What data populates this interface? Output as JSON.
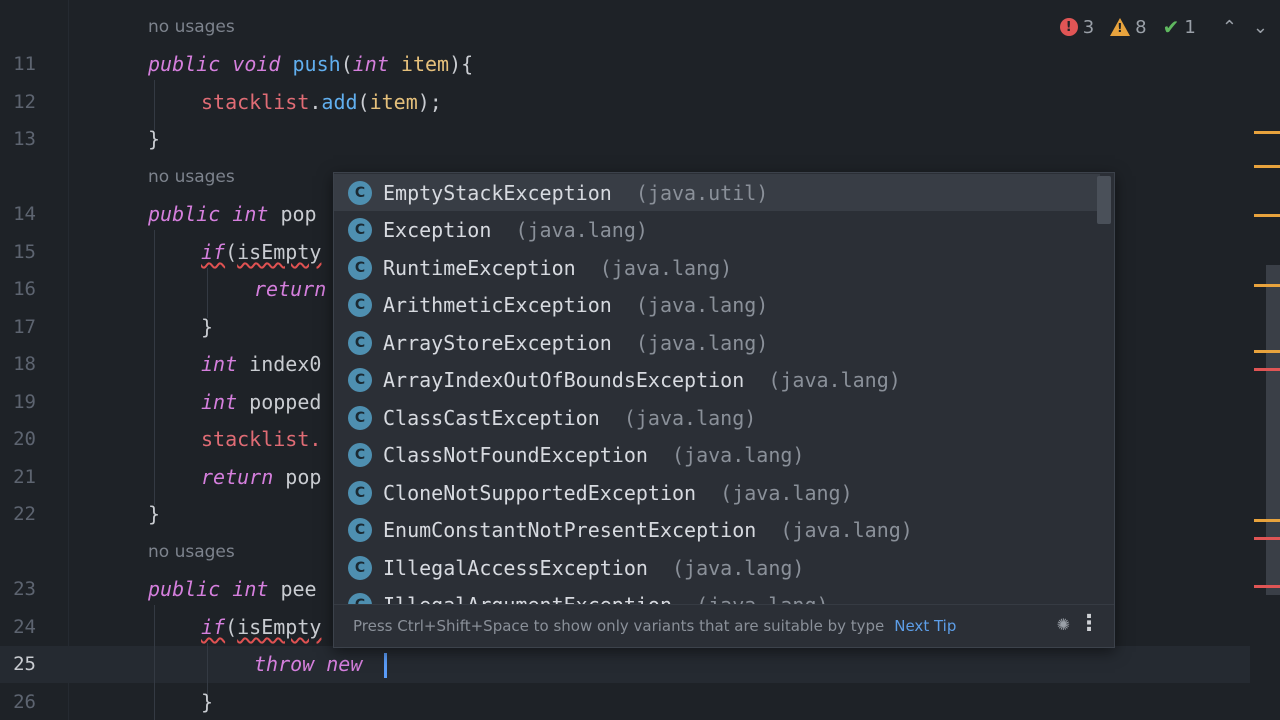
{
  "inspections": {
    "errors": "3",
    "warnings": "8",
    "ok": "1"
  },
  "hints": {
    "usages": "no usages"
  },
  "lines": {
    "n11": "11",
    "n12": "12",
    "n13": "13",
    "n14": "14",
    "n15": "15",
    "n16": "16",
    "n17": "17",
    "n18": "18",
    "n19": "19",
    "n20": "20",
    "n21": "21",
    "n22": "22",
    "n23": "23",
    "n24": "24",
    "n25": "25",
    "n26": "26"
  },
  "code": {
    "public": "public",
    "void": "void",
    "int": "int",
    "if": "if",
    "return": "return",
    "throw": "throw",
    "new": "new",
    "push": "push",
    "push_open": "(",
    "item": "item",
    "push_close": "){",
    "stacklist": "stacklist",
    "dot": ".",
    "add": "add",
    "add_args": "(",
    "add_close": ");",
    "close_brace": "}",
    "pop_partial": "pop",
    "isEmpty_partial": "isEmpty",
    "if_open": "(",
    "return_partial": "return",
    "index_partial": "index0",
    "popped_partial": "popped",
    "stacklist_dot": "stacklist.",
    "return_pop": "pop",
    "peek_partial": "pee",
    "space": " "
  },
  "completion": {
    "items": [
      {
        "name": "EmptyStackException",
        "pkg": "(java.util)"
      },
      {
        "name": "Exception",
        "pkg": "(java.lang)"
      },
      {
        "name": "RuntimeException",
        "pkg": "(java.lang)"
      },
      {
        "name": "ArithmeticException",
        "pkg": "(java.lang)"
      },
      {
        "name": "ArrayStoreException",
        "pkg": "(java.lang)"
      },
      {
        "name": "ArrayIndexOutOfBoundsException",
        "pkg": "(java.lang)"
      },
      {
        "name": "ClassCastException",
        "pkg": "(java.lang)"
      },
      {
        "name": "ClassNotFoundException",
        "pkg": "(java.lang)"
      },
      {
        "name": "CloneNotSupportedException",
        "pkg": "(java.lang)"
      },
      {
        "name": "EnumConstantNotPresentException",
        "pkg": "(java.lang)"
      },
      {
        "name": "IllegalAccessException",
        "pkg": "(java.lang)"
      },
      {
        "name": "IllegalArgumentException",
        "pkg": "(java.lang)"
      }
    ],
    "icon_letter": "C",
    "footer_tip": "Press Ctrl+Shift+Space to show only variants that are suitable by type",
    "next_tip": "Next Tip"
  },
  "icons": {
    "error": "error-circle-icon",
    "warning": "warning-triangle-icon",
    "ok": "checkmark-icon",
    "up": "chevron-up-icon",
    "down": "chevron-down-icon",
    "class": "class-icon",
    "loading": "loading-spinner-icon",
    "more": "more-vertical-icon"
  },
  "colors": {
    "background": "#1e2227",
    "keyword": "#d57fdd",
    "method": "#61afef",
    "field": "#e06c75",
    "caret": "#5a9cf8"
  }
}
